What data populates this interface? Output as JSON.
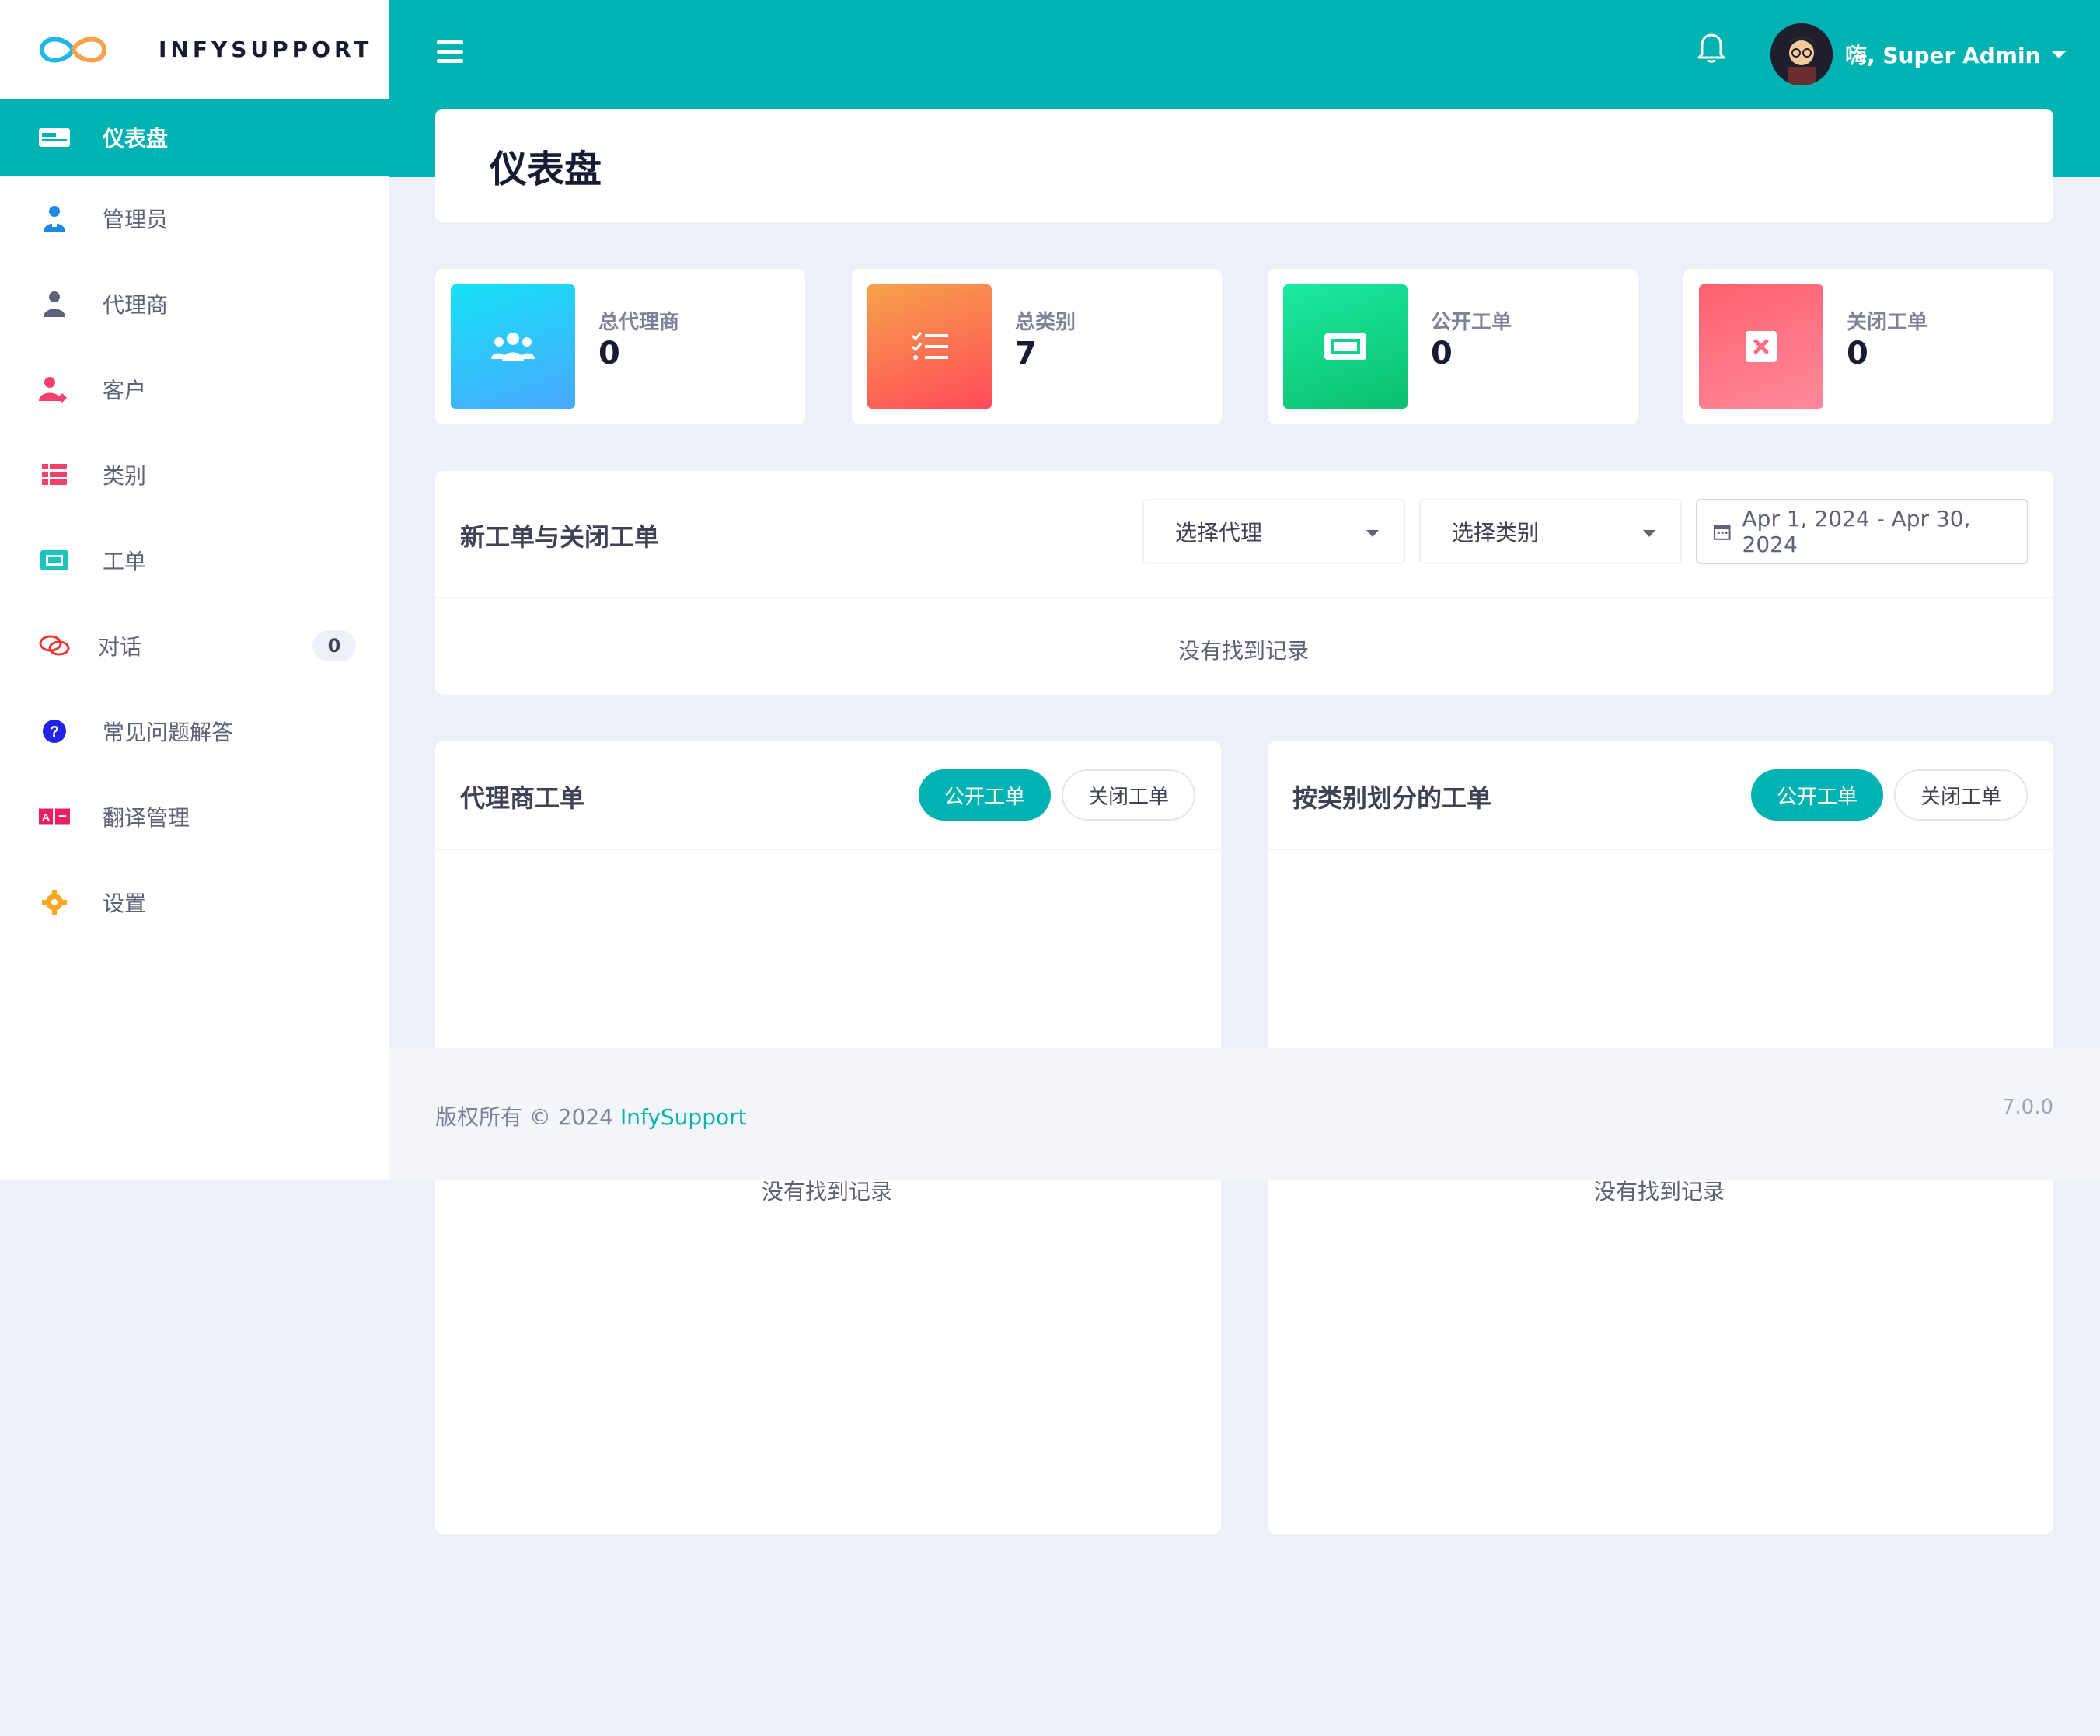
{
  "brand": {
    "name": "INFYSUPPORT"
  },
  "sidebar": {
    "items": [
      {
        "label": "仪表盘",
        "icon": "dashboard-icon",
        "active": true
      },
      {
        "label": "管理员",
        "icon": "admin-user-icon"
      },
      {
        "label": "代理商",
        "icon": "user-icon"
      },
      {
        "label": "客户",
        "icon": "customer-icon"
      },
      {
        "label": "类别",
        "icon": "list-icon"
      },
      {
        "label": "工单",
        "icon": "ticket-icon"
      },
      {
        "label": "对话",
        "icon": "chat-icon",
        "badge": "0"
      },
      {
        "label": "常见问题解答",
        "icon": "question-icon"
      },
      {
        "label": "翻译管理",
        "icon": "translate-icon"
      },
      {
        "label": "设置",
        "icon": "gear-icon"
      }
    ]
  },
  "header": {
    "user_name": "嗨, Super Admin"
  },
  "page": {
    "title": "仪表盘"
  },
  "stats": [
    {
      "label": "总代理商",
      "value": "0",
      "icon": "users-icon"
    },
    {
      "label": "总类别",
      "value": "7",
      "icon": "checklist-icon"
    },
    {
      "label": "公开工单",
      "value": "0",
      "icon": "ticket-icon"
    },
    {
      "label": "关闭工单",
      "value": "0",
      "icon": "close-box-icon"
    }
  ],
  "tickets_panel": {
    "title": "新工单与关闭工单",
    "agent_select": "选择代理",
    "category_select": "选择类别",
    "date_range": "Apr 1, 2024 - Apr 30, 2024",
    "empty": "没有找到记录"
  },
  "agent_panel": {
    "title": "代理商工单",
    "open_label": "公开工单",
    "closed_label": "关闭工单",
    "empty": "没有找到记录"
  },
  "category_panel": {
    "title": "按类别划分的工单",
    "open_label": "公开工单",
    "closed_label": "关闭工单",
    "empty": "没有找到记录"
  },
  "footer": {
    "copyright": "版权所有 © 2024",
    "brand_link": "InfySupport",
    "version": "7.0.0"
  },
  "colors": {
    "primary": "#00b2b2",
    "stat1": "#16e1f5",
    "stat2": "#f7a24a",
    "stat3": "#1be9a2",
    "stat4": "#ff6b81"
  }
}
